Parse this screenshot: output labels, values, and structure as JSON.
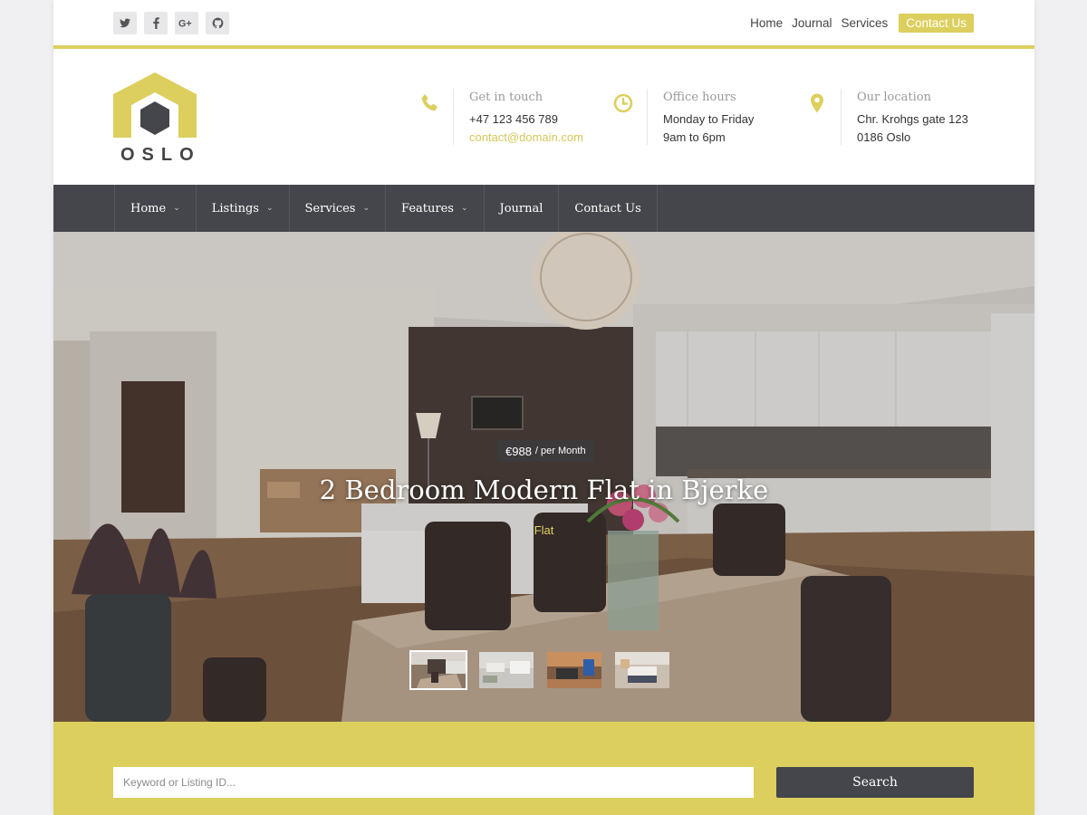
{
  "topbar": {
    "social": [
      {
        "icon": "twitter-icon"
      },
      {
        "icon": "facebook-icon"
      },
      {
        "icon": "google-plus-icon"
      },
      {
        "icon": "github-icon"
      }
    ],
    "links": [
      "Home",
      "Journal",
      "Services"
    ],
    "cta_label": "Contact Us"
  },
  "brand": {
    "name": "OSLO",
    "accent": "#dccf5e",
    "dark": "#45464b"
  },
  "contact": {
    "touch_label": "Get in touch",
    "phone": "+47 123 456 789",
    "email": "contact@domain.com",
    "hours_label": "Office hours",
    "hours_days": "Monday to Friday",
    "hours_time": "9am to 6pm",
    "location_label": "Our location",
    "address_1": "Chr. Krohgs gate 123",
    "address_2": "0186 Oslo"
  },
  "nav": {
    "items": [
      {
        "label": "Home",
        "has_dropdown": true
      },
      {
        "label": "Listings",
        "has_dropdown": true
      },
      {
        "label": "Services",
        "has_dropdown": true
      },
      {
        "label": "Features",
        "has_dropdown": true
      },
      {
        "label": "Journal",
        "has_dropdown": false
      },
      {
        "label": "Contact Us",
        "has_dropdown": false
      }
    ]
  },
  "hero": {
    "price": "€988",
    "price_period": "/ per Month",
    "title": "2 Bedroom Modern Flat in Bjerke",
    "type": "Flat",
    "active_thumb": 1,
    "thumb_count": 4
  },
  "search": {
    "placeholder": "Keyword or Listing ID...",
    "button_label": "Search"
  }
}
